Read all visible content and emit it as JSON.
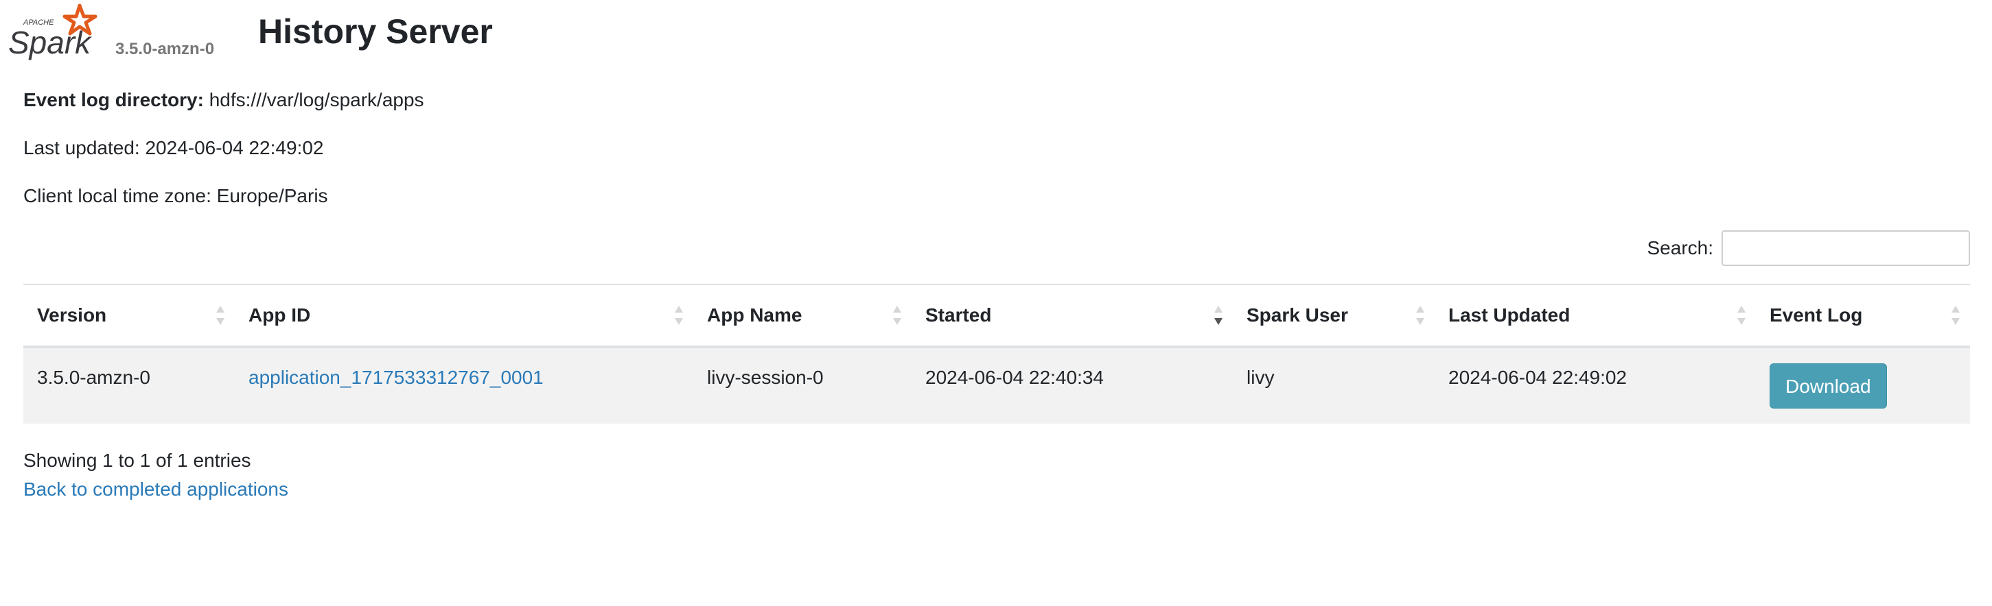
{
  "header": {
    "logo_top_text": "APACHE",
    "logo_text": "Spark",
    "version": "3.5.0-amzn-0",
    "title": "History Server"
  },
  "info": {
    "event_log_label": "Event log directory:",
    "event_log_value": "hdfs:///var/log/spark/apps",
    "last_updated": "Last updated: 2024-06-04 22:49:02",
    "time_zone": "Client local time zone: Europe/Paris"
  },
  "search": {
    "label": "Search:",
    "value": "",
    "placeholder": ""
  },
  "table": {
    "columns": [
      {
        "label": "Version",
        "sort": "none"
      },
      {
        "label": "App ID",
        "sort": "none"
      },
      {
        "label": "App Name",
        "sort": "none"
      },
      {
        "label": "Started",
        "sort": "desc"
      },
      {
        "label": "Spark User",
        "sort": "none"
      },
      {
        "label": "Last Updated",
        "sort": "none"
      },
      {
        "label": "Event Log",
        "sort": "none"
      }
    ],
    "rows": [
      {
        "version": "3.5.0-amzn-0",
        "app_id": "application_1717533312767_0001",
        "app_name": "livy-session-0",
        "started": "2024-06-04 22:40:34",
        "spark_user": "livy",
        "last_updated": "2024-06-04 22:49:02",
        "event_log": "Download"
      }
    ]
  },
  "footer": {
    "showing": "Showing 1 to 1 of 1 entries",
    "back_link": "Back to completed applications"
  },
  "colors": {
    "link": "#2a7ab8",
    "button": "#4a9fb5",
    "row_bg": "#f2f2f2",
    "logo_orange": "#e25a1c",
    "logo_gray": "#3c3a3e"
  },
  "icons": {
    "logo": "spark-logo-icon",
    "sort_both": "sort-both-icon",
    "sort_desc": "sort-desc-icon"
  }
}
